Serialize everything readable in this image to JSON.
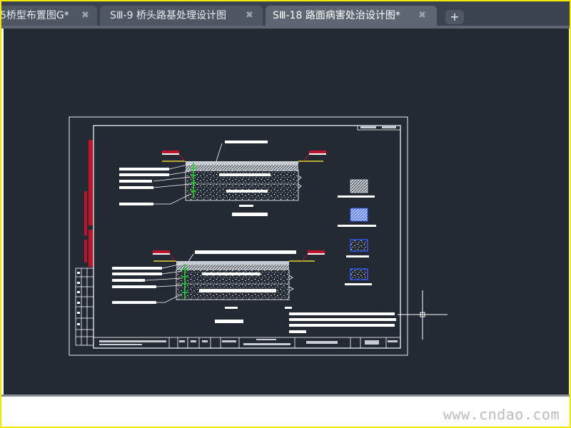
{
  "tabs": [
    {
      "label": "5桥型布置图G*",
      "close": "✖",
      "active": false
    },
    {
      "label": "SⅢ-9 桥头路基处理设计图",
      "close": "✖",
      "active": false
    },
    {
      "label": "SⅢ-18 路面病害处治设计图*",
      "close": "✖",
      "active": true
    }
  ],
  "add_tab": "+",
  "drawing": {
    "sheet_number": "SⅢ-18",
    "colors": {
      "background": "#232a34",
      "linework": "#ffffff",
      "frame": "#c8ccd2",
      "red": "#c0142a",
      "yellow": "#e6d22a",
      "green": "#1cd12e",
      "blue": "#2f5bff"
    }
  },
  "watermark": "www.cndao.com",
  "icons": {
    "tab_close": "close-icon",
    "add_tab": "plus-icon",
    "cursor": "crosshair-icon"
  }
}
